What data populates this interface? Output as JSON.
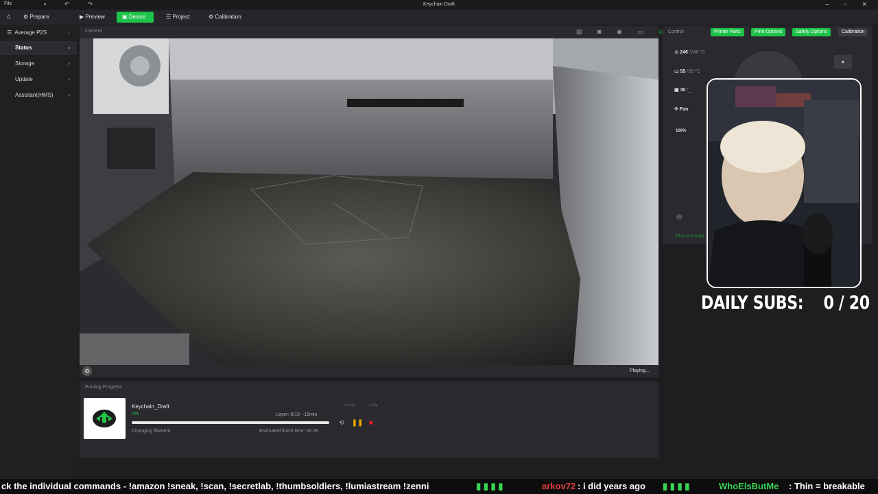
{
  "titlebar": {
    "title": "Keychain Draft",
    "file_menu": "File"
  },
  "nav": {
    "items": [
      "Prepare",
      "Preview",
      "Device",
      "Project",
      "Calibration"
    ],
    "active": "Device"
  },
  "sidebar": {
    "printer": "Average P2S",
    "items": [
      "Status",
      "Storage",
      "Update",
      "Assistant(HMS)"
    ]
  },
  "camera": {
    "label": "Camera",
    "status": "Playing..."
  },
  "progress": {
    "section_title": "Printing Progress",
    "job_name": "Keychain_Draft",
    "percent_label": "0%",
    "progress_fraction": 0.0,
    "layer": "Layer: 0/19",
    "remaining": "-19min",
    "stage": "Changing filament",
    "eta": "Estimated finish time: 00:35",
    "stat_a": "19m44s",
    "stat_b": "5.88g"
  },
  "control": {
    "label": "Control",
    "buttons": [
      "Printer Parts",
      "Print Options",
      "Safety Options",
      "Calibration"
    ],
    "nozzle": {
      "value": "246",
      "target": "/240",
      "unit": "°C"
    },
    "bed": {
      "value": "55",
      "target": "/55",
      "unit": "°C"
    },
    "chamber": {
      "value": "30",
      "target": "/_"
    },
    "fan_label": "Fan",
    "fan_speed": "100%",
    "filament_link": "Filament load"
  },
  "overlay": {
    "subs_label": "DAILY SUBS:",
    "subs_value": "0 / 20"
  },
  "ticker": {
    "text1": "ck the individual commands - !amazon !sneak, !scan, !secretlab, !thumbsoldiers, !lumiastream !zenni",
    "user1": "arkov72",
    "msg1": ": i did years ago",
    "user2": "WhoElsButMe",
    "msg2": ": Thin = breakable"
  },
  "colors": {
    "accent": "#1ec34a",
    "bg": "#1e1e21",
    "panel": "#2a2a2e",
    "stop": "#e02020",
    "pause": "#f2a900"
  }
}
